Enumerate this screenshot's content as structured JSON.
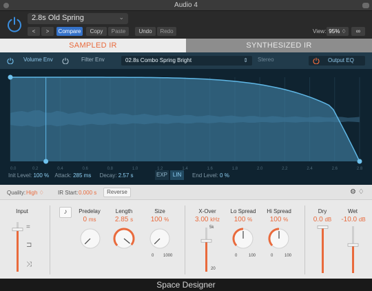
{
  "window": {
    "title": "Audio 4"
  },
  "header": {
    "preset": "2.8s Old Spring",
    "back_glyph": "<",
    "forward_glyph": ">",
    "compare": "Compare",
    "copy": "Copy",
    "paste": "Paste",
    "undo": "Undo",
    "redo": "Redo",
    "view_label": "View:",
    "view_zoom": "95% ♢",
    "link_glyph": "∞"
  },
  "tabs": {
    "sampled": "SAMPLED IR",
    "synthesized": "SYNTHESIZED IR"
  },
  "graph_bar": {
    "volume_env": "Volume Env",
    "filter_env": "Filter Env",
    "ir_name": "02.8s Combo Spring Bright",
    "stereo": "Stereo",
    "output_eq": "Output EQ"
  },
  "graph": {
    "time_ticks": [
      "0.0",
      "0.2",
      "0.4",
      "0.6",
      "0.8",
      "1.0",
      "1.2",
      "1.4",
      "1.6",
      "1.8",
      "2.0",
      "2.2",
      "2.4",
      "2.6",
      "2.8"
    ],
    "duration_s": 2.8,
    "attack_s": 0.285,
    "decay_s": 2.57,
    "init_level_pct": 100,
    "end_level_pct": 0,
    "init_level_label": "Init Level:",
    "init_level_value": "100 %",
    "attack_label": "Attack:",
    "attack_value": "285 ms",
    "decay_label": "Decay:",
    "decay_value": "2.57 s",
    "exp": "EXP",
    "lin": "LIN",
    "end_level_label": "End Level:",
    "end_level_value": "0 %"
  },
  "controls_row": {
    "quality_label": "Quality:",
    "quality_value": "High ♢",
    "ir_start_label": "IR Start:",
    "ir_start_value": "0.000 s",
    "reverse": "Reverse",
    "settings_glyph": "⚙ ♢"
  },
  "panel": {
    "input": {
      "label": "Input",
      "fader_level": 0.85
    },
    "note_glyph": "♪",
    "predelay": {
      "label": "Predelay",
      "value": "0",
      "unit": "ms",
      "fraction": 0.0
    },
    "length": {
      "label": "Length",
      "value": "2.85",
      "unit": "s",
      "fraction": 0.98
    },
    "size": {
      "label": "Size",
      "value": "100",
      "unit": "%",
      "fraction": 0.0,
      "min": "0",
      "max": "1000"
    },
    "xover": {
      "label": "X-Over",
      "value": "3.00",
      "unit": "kHz",
      "fader_level": 0.7,
      "top": "5k",
      "bottom": "20"
    },
    "lo_spread": {
      "label": "Lo Spread",
      "value": "100",
      "unit": "%",
      "fraction": 0.5,
      "min": "0",
      "max": "100"
    },
    "hi_spread": {
      "label": "Hi Spread",
      "value": "100",
      "unit": "%",
      "fraction": 0.5,
      "min": "0",
      "max": "100"
    },
    "dry": {
      "label": "Dry",
      "value": "0.0",
      "unit": "dB",
      "fader_level": 0.98
    },
    "wet": {
      "label": "Wet",
      "value": "-10.0",
      "unit": "dB",
      "fader_level": 0.6
    }
  },
  "footer": {
    "title": "Space Designer"
  },
  "colors": {
    "accent": "#e96a3c",
    "env": "#5fb7e6",
    "env_fill": "#3f7d9f",
    "tab_inactive": "#8d8d8d"
  }
}
